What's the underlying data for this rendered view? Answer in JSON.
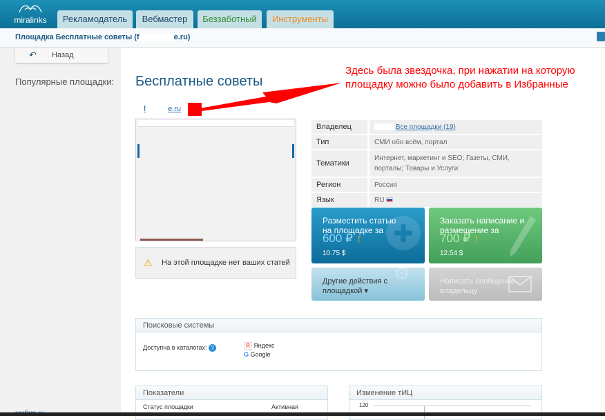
{
  "header": {
    "logo": "miralinks",
    "tabs": [
      {
        "label": "Рекламодатель",
        "color": "#1c4a6a"
      },
      {
        "label": "Вебмастер",
        "color": "#1c4a6a"
      },
      {
        "label": "Беззаботный",
        "color": "#2f8a2f"
      },
      {
        "label": "Инструменты",
        "color": "#f08a1c"
      }
    ]
  },
  "breadcrumb": {
    "prefix": "Площадка Бесплатные советы (f",
    "suffix": "e.ru)"
  },
  "sidebar": {
    "back": "Назад",
    "popular": "Популярные площадки:",
    "link": "rosfirm.ru"
  },
  "page": {
    "title": "Бесплатные советы",
    "site_prefix": "f",
    "site_suffix": "e.ru",
    "annotation": "Здесь была звездочка, при нажатии на которую площадку можно было добавить в Избранные",
    "warning": "На этой площадке нет ваших статей"
  },
  "info": [
    {
      "key": "Владелец",
      "value": "",
      "link": "Все площадки (19)"
    },
    {
      "key": "Тип",
      "value": "СМИ обо всём, портал"
    },
    {
      "key": "Тематики",
      "value": "Интернет, маркетинг и SEO; Газеты, СМИ, порталы; Товары и Услуги"
    },
    {
      "key": "Регион",
      "value": "Россия"
    },
    {
      "key": "Язык",
      "value": "RU"
    }
  ],
  "actions": {
    "place": {
      "title": "Разместить статью на площадке за",
      "price": "600 ₽",
      "usd": "10.75 $"
    },
    "order": {
      "title": "Заказать написание и размещение за",
      "price": "700 ₽",
      "usd": "12.54 $"
    },
    "other": "Другие действия с площадкой ▾",
    "message": "Написать сообщение владельцу"
  },
  "search": {
    "title": "Поисковые системы",
    "label": "Доступна в каталогах:",
    "engines": [
      "Яндекс",
      "Google"
    ]
  },
  "stats": {
    "title": "Показатели",
    "rows": [
      {
        "key": "Статус площадки",
        "value": "Активная"
      }
    ]
  },
  "tic": {
    "title": "Изменение тИЦ",
    "tick": "120"
  }
}
